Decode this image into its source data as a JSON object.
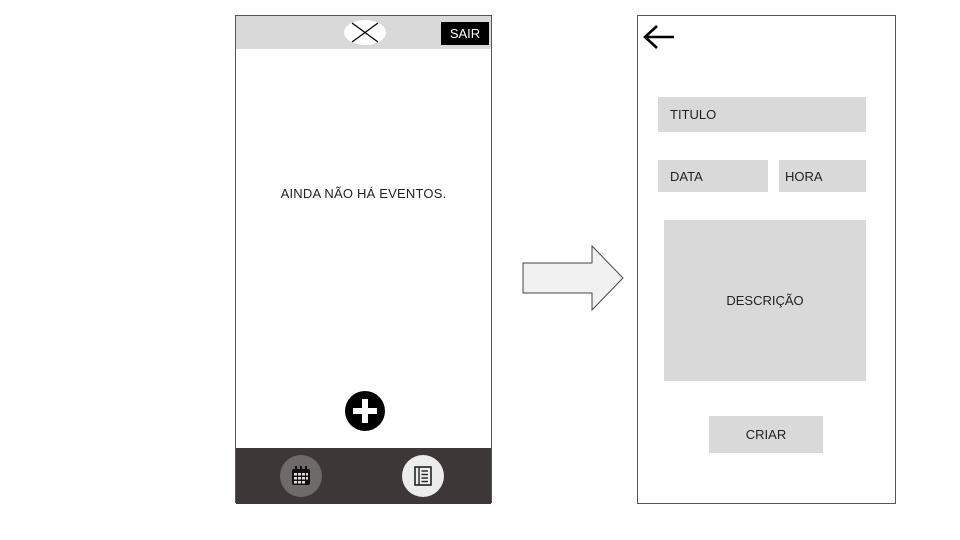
{
  "events_screen": {
    "logout_label": "SAIR",
    "empty_message": "AINDA NÃO HÁ EVENTOS.",
    "icons": {
      "logo": "image-placeholder-icon",
      "add": "plus-circle-icon",
      "calendar": "calendar-icon",
      "list": "list-icon"
    }
  },
  "create_event_screen": {
    "back_icon": "arrow-left-icon",
    "title_placeholder": "TITULO",
    "date_placeholder": "DATA",
    "time_placeholder": "HORA",
    "description_placeholder": "DESCRIÇÃO",
    "create_label": "CRIAR"
  },
  "colors": {
    "header_bg": "#d9d9d9",
    "bottom_nav_bg": "#3d3837",
    "field_bg": "#d9d9d9",
    "button_dark": "#000000"
  }
}
